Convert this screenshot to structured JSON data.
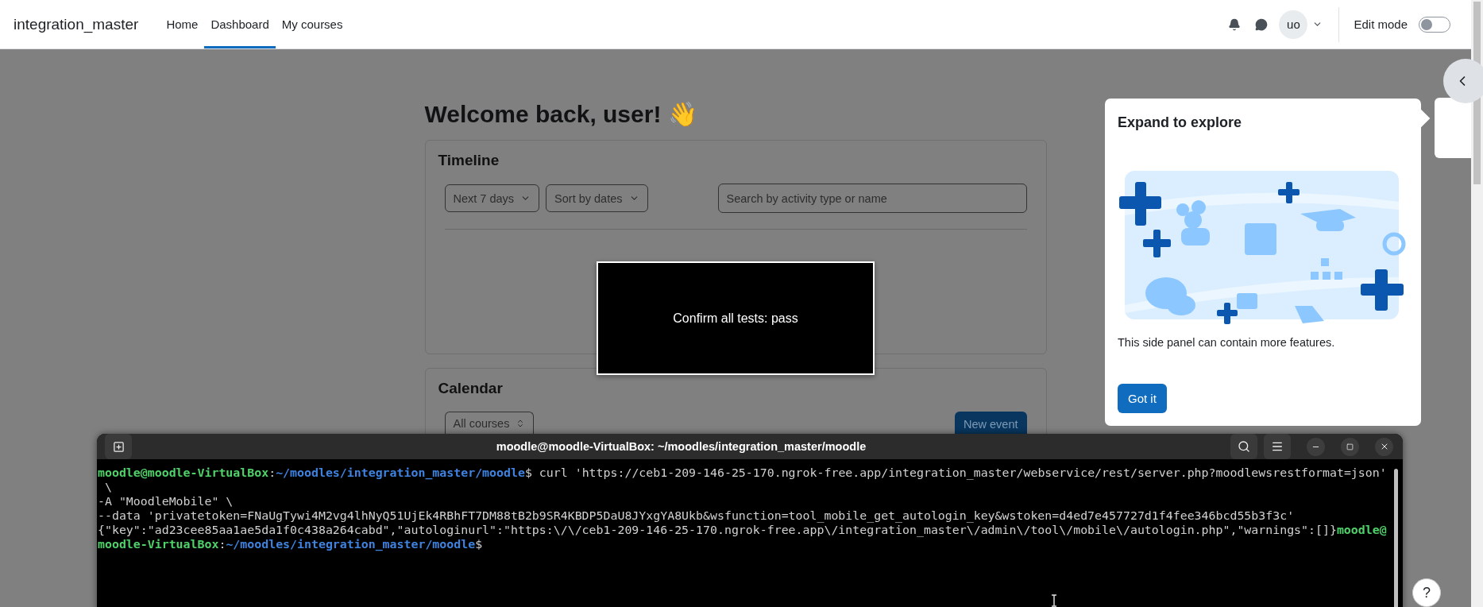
{
  "navbar": {
    "brand": "integration_master",
    "links": [
      {
        "label": "Home",
        "selected": false
      },
      {
        "label": "Dashboard",
        "selected": true
      },
      {
        "label": "My courses",
        "selected": false
      }
    ],
    "avatar_initials": "uo",
    "edit_mode": {
      "label": "Edit mode",
      "on": false
    }
  },
  "welcome": "Welcome back, user! 👋",
  "timeline": {
    "title": "Timeline",
    "filters": [
      "Next 7 days",
      "Sort by dates"
    ],
    "search": {
      "placeholder": "Search by activity type or name"
    }
  },
  "calendar": {
    "title": "Calendar",
    "course_select": "All courses",
    "new_event": "New event"
  },
  "dialog": {
    "message": "Confirm all tests: pass"
  },
  "tour": {
    "title": "Expand to explore",
    "body": "This side panel can contain more features.",
    "button": "Got it"
  },
  "help_button": "?",
  "terminal": {
    "title": "moodle@moodle-VirtualBox: ~/moodles/integration_master/moodle",
    "lines": [
      [
        {
          "kind": "user",
          "text": "moodle@moodle-VirtualBox"
        },
        {
          "kind": "plain",
          "text": ":"
        },
        {
          "kind": "path",
          "text": "~/moodles/integration_master/moodle"
        },
        {
          "kind": "plain",
          "text": "$ curl 'https://ceb1-209-146-25-170.ngrok-free.app/integration_master/webservice/rest/server.php?moodlewsrestformat=json'"
        }
      ],
      [
        {
          "kind": "plain",
          "text": " \\"
        }
      ],
      [
        {
          "kind": "plain",
          "text": "-A \"MoodleMobile\" \\"
        }
      ],
      [
        {
          "kind": "plain",
          "text": "--data 'privatetoken=FNaUgTywi4M2vg4lhNyQ51UjEk4RBhFT7DM88tB2b9SR4KBDP5DaU8JYxgYA8Ukb&wsfunction=tool_mobile_get_autologin_key&wstoken=d4ed7e457727d1f4fee346bcd55b3f3c'"
        }
      ],
      [
        {
          "kind": "plain",
          "text": "{\"key\":\"ad23cee85aa1ae5da1f0c438a264cabd\",\"autologinurl\":\"https:\\/\\/ceb1-209-146-25-170.ngrok-free.app\\/integration_master\\/admin\\/tool\\/mobile\\/autologin.php\",\"warnings\":[]}"
        },
        {
          "kind": "user",
          "text": "moodle@"
        }
      ],
      [
        {
          "kind": "user",
          "text": "moodle-VirtualBox"
        },
        {
          "kind": "plain",
          "text": ":"
        },
        {
          "kind": "path",
          "text": "~/moodles/integration_master/moodle"
        },
        {
          "kind": "plain",
          "text": "$"
        }
      ]
    ]
  }
}
